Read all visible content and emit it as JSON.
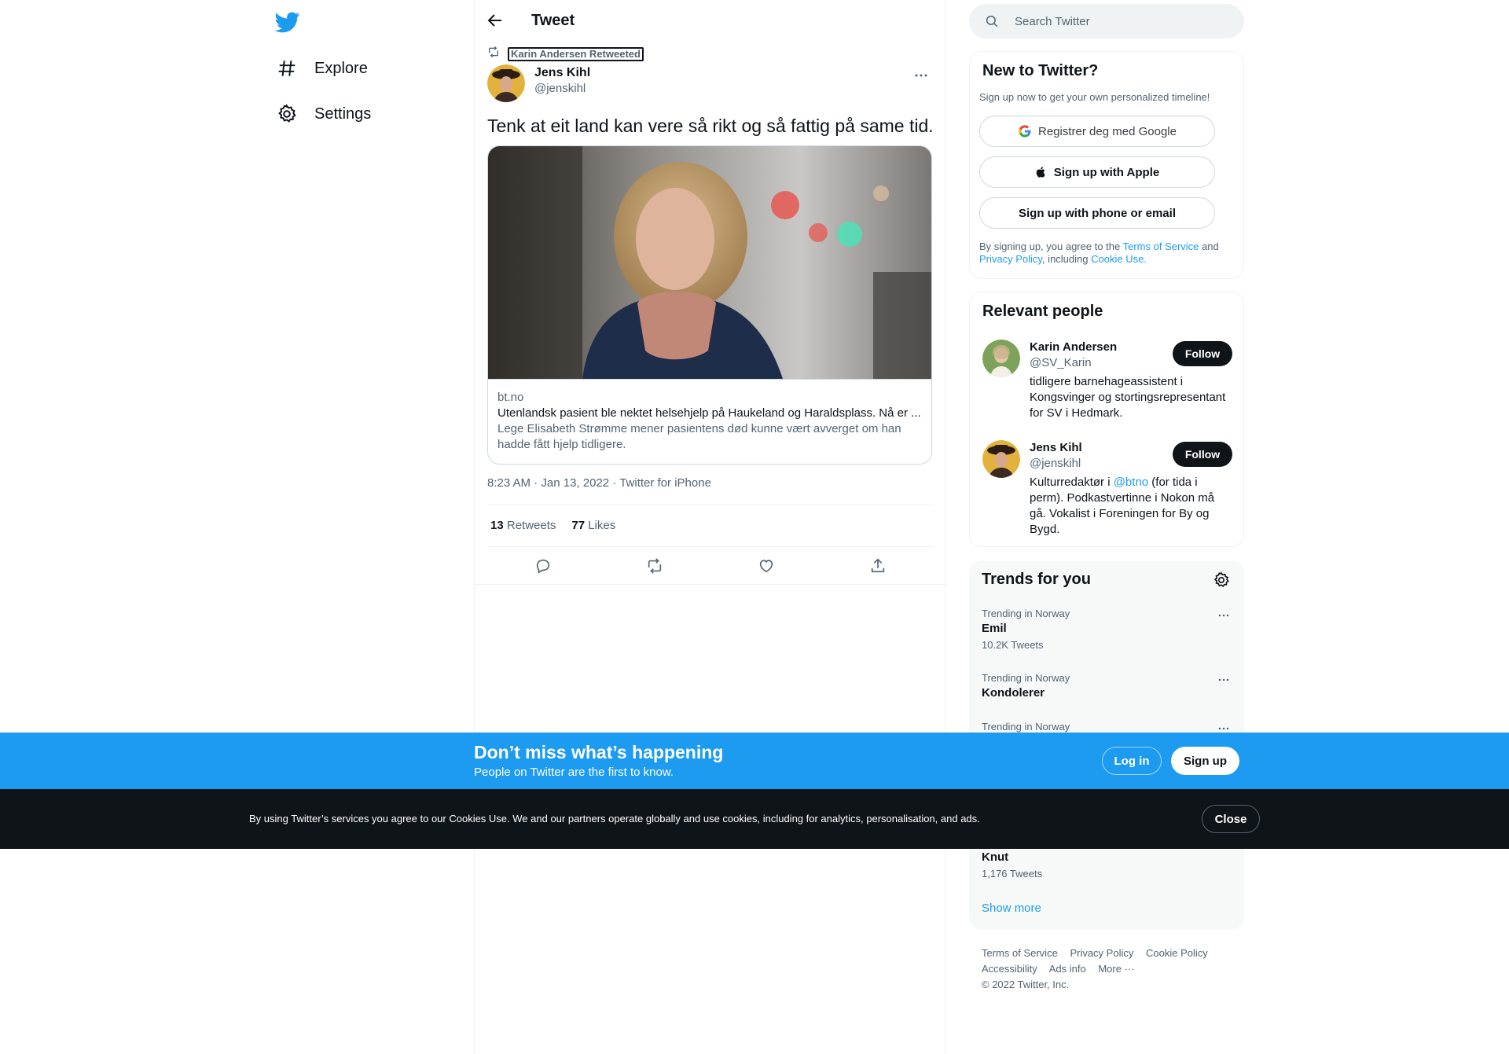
{
  "nav": {
    "items": [
      {
        "label": "Explore",
        "icon": "hashtag-icon"
      },
      {
        "label": "Settings",
        "icon": "gear-icon"
      }
    ]
  },
  "header": {
    "title": "Tweet"
  },
  "retweet": {
    "label": "Karin Andersen Retweeted"
  },
  "tweet": {
    "author_name": "Jens Kihl",
    "author_handle": "@jenskihl",
    "text": "Tenk at eit land kan vere så rikt og så fattig på same tid.",
    "card": {
      "domain": "bt.no",
      "title": "Utenlandsk pasient ble nektet helsehjelp på Haukeland og Haraldsplass. Nå er ...",
      "description": "Lege Elisabeth Strømme mener pasientens død kunne vært avverget om han hadde fått hjelp tidligere."
    },
    "time": "8:23 AM",
    "date": "Jan 13, 2022",
    "source": "Twitter for iPhone",
    "separator": " · ",
    "retweets": "13",
    "retweets_label": "Retweets",
    "likes": "77",
    "likes_label": "Likes"
  },
  "search": {
    "placeholder": "Search Twitter"
  },
  "new_to_twitter": {
    "title": "New to Twitter?",
    "subtitle": "Sign up now to get your own personalized timeline!",
    "google_label": "Registrer deg med Google",
    "apple_label": "Sign up with Apple",
    "phone_label": "Sign up with phone or email",
    "legal_prefix": "By signing up, you agree to the ",
    "terms": "Terms of Service",
    "and": " and ",
    "privacy": "Privacy Policy",
    "including": ", including ",
    "cookie_use": "Cookie Use."
  },
  "relevant_people": {
    "title": "Relevant people",
    "people": [
      {
        "name": "Karin Andersen",
        "handle": "@SV_Karin",
        "bio": "tidligere barnehageassistent i Kongsvinger og stortingsrepresentant for SV i Hedmark.",
        "follow": "Follow"
      },
      {
        "name": "Jens Kihl",
        "handle": "@jenskihl",
        "bio_prefix": "Kulturredaktør i ",
        "bio_mention": "@btno",
        "bio_suffix": " (for tida i perm). Podkastvertinne i Nokon må gå. Vokalist i Foreningen for By og Bygd.",
        "follow": "Follow"
      }
    ]
  },
  "trends": {
    "title": "Trends for you",
    "items": [
      {
        "context": "Trending in Norway",
        "name": "Emil",
        "count": "10.2K Tweets"
      },
      {
        "context": "Trending in Norway",
        "name": "Kondolerer",
        "count": ""
      },
      {
        "context": "Trending in Norway",
        "name": "",
        "count": ""
      },
      {
        "context": "",
        "name": "Knut",
        "count": "1,176 Tweets"
      }
    ],
    "show_more": "Show more"
  },
  "footer": {
    "links": [
      "Terms of Service",
      "Privacy Policy",
      "Cookie Policy",
      "Accessibility",
      "Ads info",
      "More ···"
    ],
    "copyright": "© 2022 Twitter, Inc."
  },
  "miss_bar": {
    "title": "Don’t miss what’s happening",
    "subtitle": "People on Twitter are the first to know.",
    "login": "Log in",
    "signup": "Sign up"
  },
  "cookie_bar": {
    "text": "By using Twitter’s services you agree to our Cookies Use. We and our partners operate globally and use cookies, including for analytics, personalisation, and ads.",
    "close": "Close"
  },
  "colors": {
    "accent": "#1d9bf0",
    "text": "#0f1419",
    "muted": "#536471",
    "cookie_bg": "#0f1419"
  }
}
